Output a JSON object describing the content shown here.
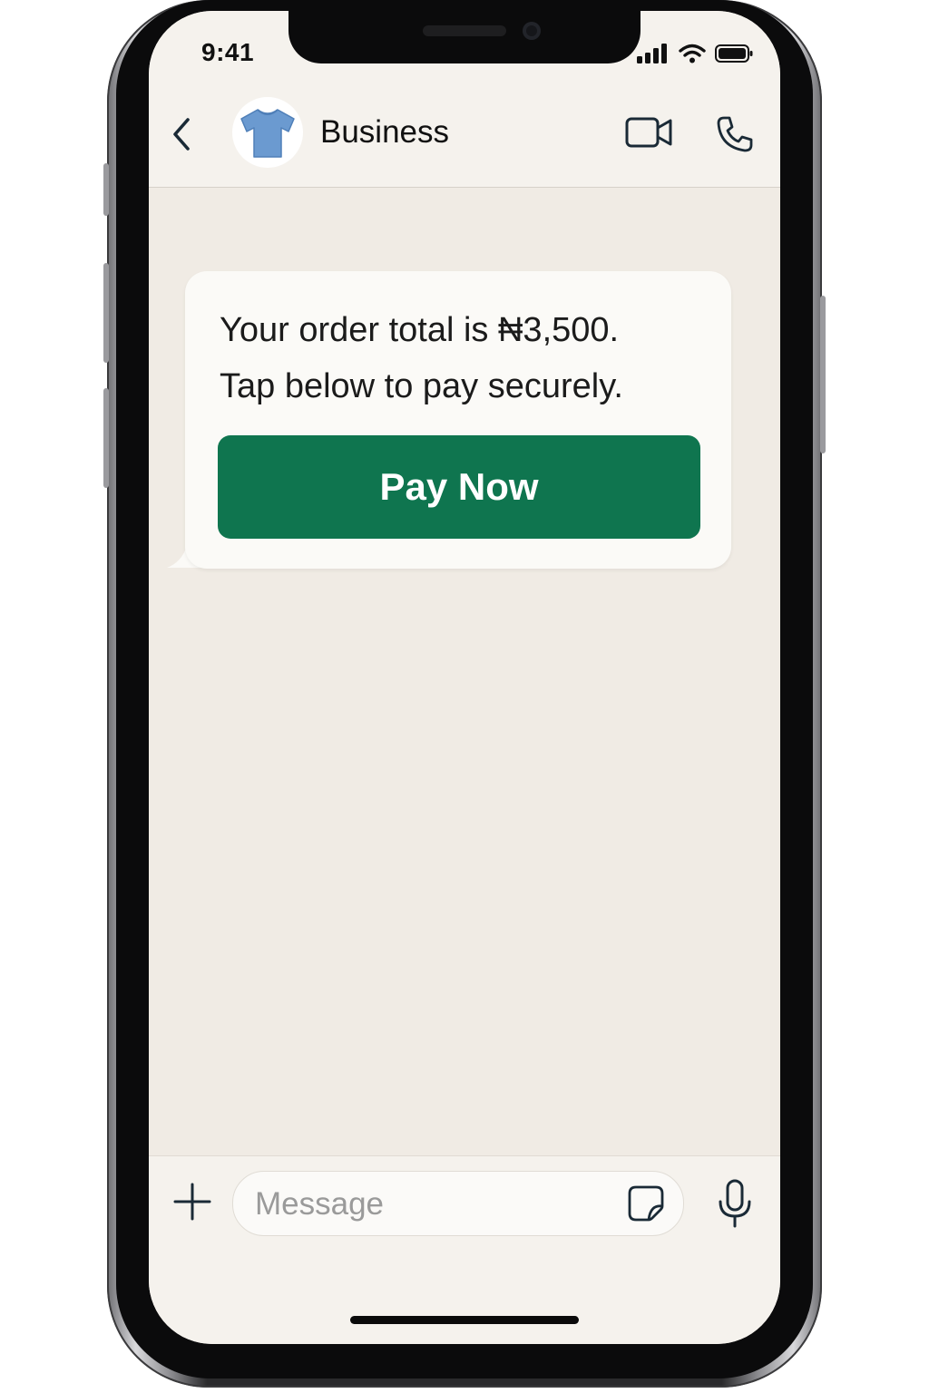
{
  "status_bar": {
    "time": "9:41",
    "icons": [
      "cellular-signal-icon",
      "wifi-icon",
      "battery-icon"
    ]
  },
  "chat_header": {
    "contact_name": "Business",
    "avatar": "tshirt-icon",
    "actions": [
      "back-chevron-icon",
      "video-camera-icon",
      "phone-icon"
    ]
  },
  "message": {
    "line1": "Your order total is ₦3,500.",
    "line2": "Tap below to pay securely.",
    "button_label": "Pay Now"
  },
  "composer": {
    "placeholder": "Message",
    "icons": [
      "plus-icon",
      "sticker-icon",
      "microphone-icon"
    ]
  },
  "colors": {
    "pay_button": "#0f754f",
    "chat_background": "#f0ebe4",
    "header_background": "#f5f2ed",
    "bubble_background": "#fbfaf7",
    "icon_color": "#1a2a36"
  }
}
